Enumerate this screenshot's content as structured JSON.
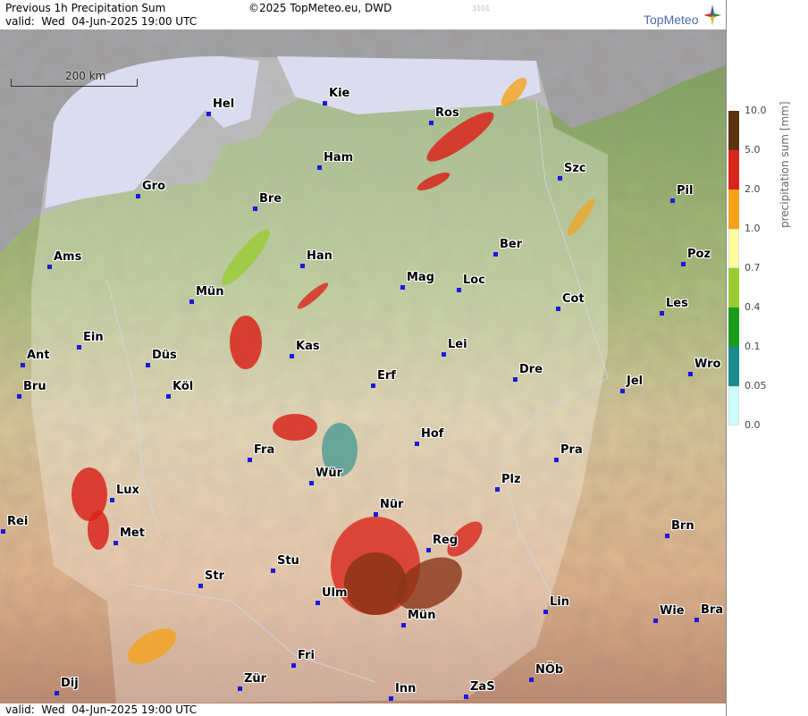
{
  "header": {
    "title": "Previous 1h Precipitation Sum",
    "valid": "valid:  Wed  04-Jun-2025 19:00 UTC",
    "copyright": "©2025 TopMeteo.eu, DWD",
    "code": "3101",
    "logo": "TopMeteo"
  },
  "footer": {
    "valid": "valid:  Wed  04-Jun-2025 19:00 UTC"
  },
  "scale": {
    "label": "200 km"
  },
  "legend": {
    "title": "precipitation sum [mm]",
    "labels": [
      "10.0",
      "5.0",
      "2.0",
      "1.0",
      "0.7",
      "0.4",
      "0.1",
      "0.05",
      "0.0"
    ],
    "colors": [
      "#5a3311",
      "#d9261c",
      "#f4a21b",
      "#ffff99",
      "#99cc33",
      "#1c9a1c",
      "#1a8a8a",
      "#ccffff"
    ]
  },
  "cities": [
    "Hel",
    "Kie",
    "Ros",
    "Ham",
    "Gro",
    "Bre",
    "Szc",
    "Pil",
    "Ams",
    "Han",
    "Ber",
    "Poz",
    "Mün",
    "Mag",
    "Loc",
    "Cot",
    "Les",
    "Ein",
    "Kas",
    "Lei",
    "Ant",
    "Düs",
    "Wro",
    "Bru",
    "Köl",
    "Erf",
    "Dre",
    "Jel",
    "Hof",
    "Fra",
    "Pra",
    "Lux",
    "Wür",
    "Plz",
    "Rei",
    "Nür",
    "Met",
    "Reg",
    "Brn",
    "Stu",
    "Str",
    "Ulm",
    "Lin",
    "Wie",
    "Bra",
    "Mün",
    "Fri",
    "NÖb",
    "Dij",
    "Zür",
    "Inn",
    "ZaS"
  ]
}
